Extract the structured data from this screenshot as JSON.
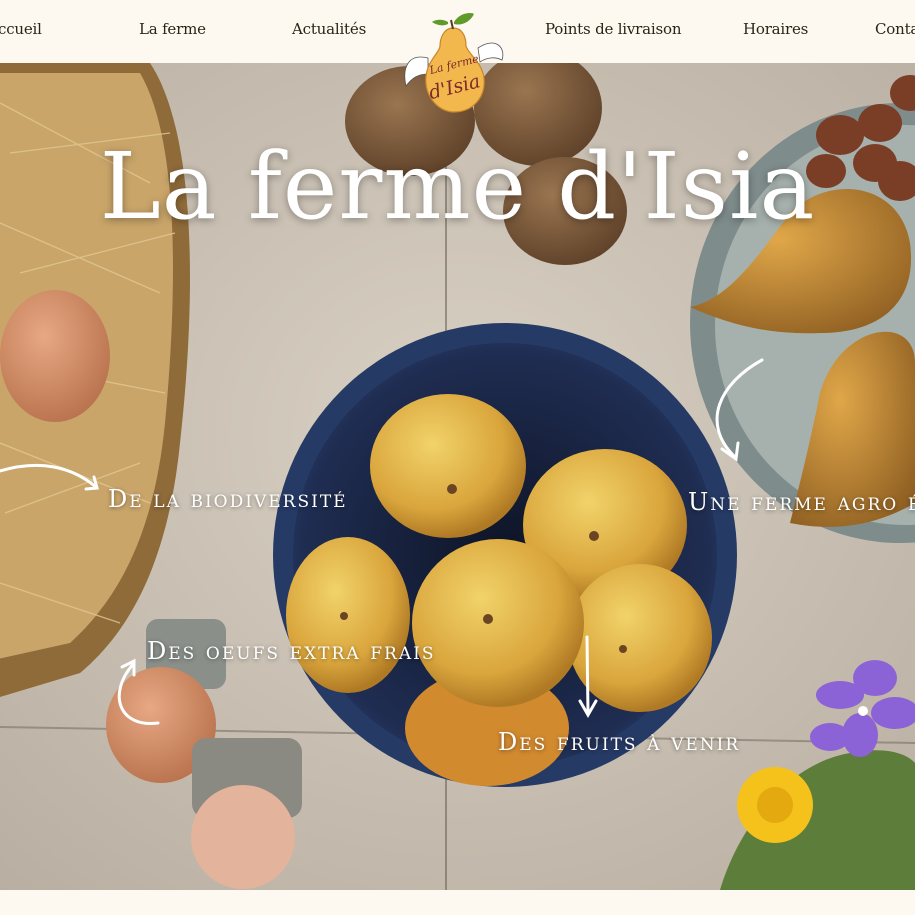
{
  "nav": {
    "items": [
      {
        "label": "ccueil"
      },
      {
        "label": "La ferme"
      },
      {
        "label": "Actualités"
      },
      {
        "label": "Points de livraison"
      },
      {
        "label": "Horaires"
      },
      {
        "label": "Contac"
      }
    ],
    "logo_text": "La ferme d'Isia"
  },
  "hero": {
    "title": "La ferme d'Isia",
    "tags": {
      "biodiversity": "De la biodiversité",
      "agro": "Une ferme agro éco",
      "eggs": "Des oeufs extra frais",
      "fruits": "Des fruits à venir"
    }
  },
  "colors": {
    "background": "#fdf9f1",
    "nav_text": "#2c2416",
    "stone": "#cfc7bb",
    "bowl_blue": "#1d2a4a",
    "apple": "#d6a93e",
    "pear": "#b9822f",
    "kiwi": "#7a5a3c"
  }
}
